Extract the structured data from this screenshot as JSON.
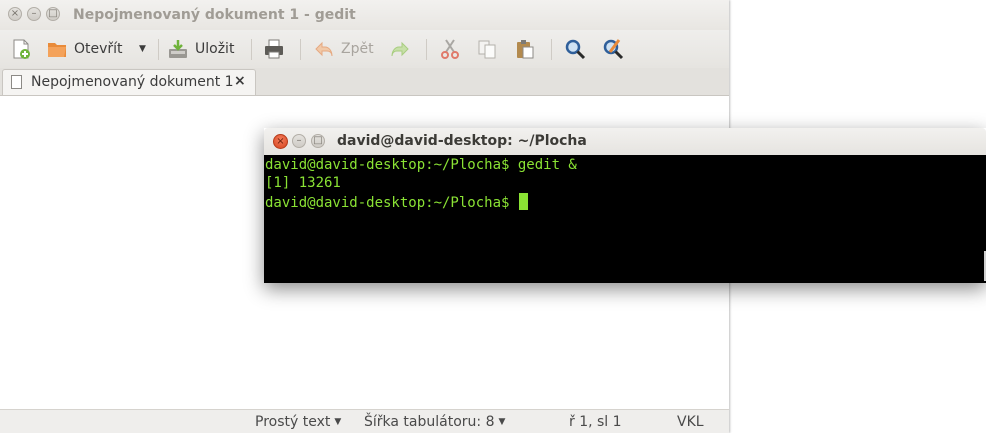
{
  "gedit": {
    "window_title": "Nepojmenovaný dokument 1 - gedit",
    "toolbar": {
      "new_icon": "new-document-icon",
      "open_label": "Otevřít",
      "save_label": "Uložit",
      "undo_label": "Zpět"
    },
    "tab": {
      "label": "Nepojmenovaný dokument 1",
      "close": "×"
    },
    "statusbar": {
      "syntax": "Prostý text",
      "tab_width": "Šířka tabulátoru: 8",
      "position": "ř 1, sl 1",
      "mode": "VKL"
    }
  },
  "terminal": {
    "title": "david@david-desktop: ~/Plocha",
    "lines": [
      "david@david-desktop:~/Plocha$ gedit &",
      "[1] 13261",
      "david@david-desktop:~/Plocha$ "
    ],
    "text_color": "#8ae234",
    "background": "#000000"
  },
  "colors": {
    "close_button": "#e0582f",
    "panel": "#efeeec"
  }
}
